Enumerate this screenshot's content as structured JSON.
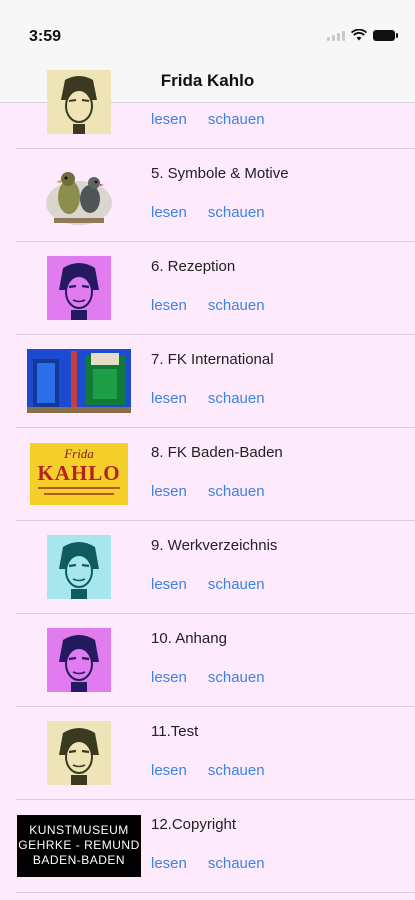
{
  "status": {
    "time": "3:59"
  },
  "nav": {
    "title": "Frida Kahlo"
  },
  "rows": [
    {
      "title": "",
      "read": "lesen",
      "view": "schauen"
    },
    {
      "title": "5. Symbole & Motive",
      "read": "lesen",
      "view": "schauen"
    },
    {
      "title": "6. Rezeption",
      "read": "lesen",
      "view": "schauen"
    },
    {
      "title": "7. FK International",
      "read": "lesen",
      "view": "schauen"
    },
    {
      "title": "8. FK Baden-Baden",
      "read": "lesen",
      "view": "schauen"
    },
    {
      "title": "9. Werkverzeichnis",
      "read": "lesen",
      "view": "schauen"
    },
    {
      "title": "10. Anhang",
      "read": "lesen",
      "view": "schauen"
    },
    {
      "title": "11.Test",
      "read": "lesen",
      "view": "schauen"
    },
    {
      "title": "12.Copyright",
      "read": "lesen",
      "view": "schauen"
    }
  ],
  "banner_baden": {
    "line1": "Frida",
    "line2": "KAHLO"
  },
  "banner_museum": {
    "line1": "KUNSTMUSEUM",
    "line2": "GEHRKE - REMUND",
    "line3": "BADEN-BADEN"
  },
  "colors": {
    "background": "#fdeafd",
    "link": "#3c84e1",
    "separator": "#d9cfd9"
  }
}
